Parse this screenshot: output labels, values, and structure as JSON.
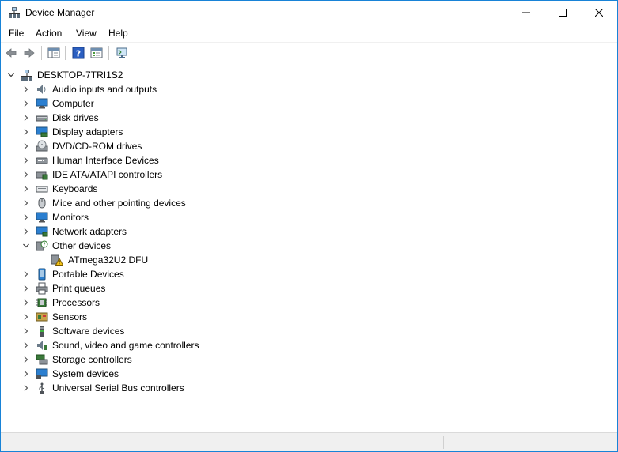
{
  "window": {
    "title": "Device Manager"
  },
  "menu": [
    "File",
    "Action",
    "View",
    "Help"
  ],
  "toolbar": {
    "buttons": [
      "back-icon",
      "forward-icon",
      "show-hide-console-tree-icon",
      "help-icon",
      "properties-icon",
      "scan-hardware-icon"
    ]
  },
  "tree": {
    "root": "DESKTOP-7TRI1S2",
    "categories": [
      {
        "label": "Audio inputs and outputs",
        "icon": "speaker-icon",
        "expanded": false
      },
      {
        "label": "Computer",
        "icon": "computer-icon",
        "expanded": false
      },
      {
        "label": "Disk drives",
        "icon": "disk-drive-icon",
        "expanded": false
      },
      {
        "label": "Display adapters",
        "icon": "display-adapter-icon",
        "expanded": false
      },
      {
        "label": "DVD/CD-ROM drives",
        "icon": "dvd-drive-icon",
        "expanded": false
      },
      {
        "label": "Human Interface Devices",
        "icon": "hid-icon",
        "expanded": false
      },
      {
        "label": "IDE ATA/ATAPI controllers",
        "icon": "ide-controller-icon",
        "expanded": false
      },
      {
        "label": "Keyboards",
        "icon": "keyboard-icon",
        "expanded": false
      },
      {
        "label": "Mice and other pointing devices",
        "icon": "mouse-icon",
        "expanded": false
      },
      {
        "label": "Monitors",
        "icon": "monitor-icon",
        "expanded": false
      },
      {
        "label": "Network adapters",
        "icon": "network-adapter-icon",
        "expanded": false
      },
      {
        "label": "Other devices",
        "icon": "unknown-device-icon",
        "expanded": true,
        "children": [
          {
            "label": "ATmega32U2 DFU",
            "icon": "warning-device-icon"
          }
        ]
      },
      {
        "label": "Portable Devices",
        "icon": "portable-device-icon",
        "expanded": false
      },
      {
        "label": "Print queues",
        "icon": "printer-icon",
        "expanded": false
      },
      {
        "label": "Processors",
        "icon": "processor-icon",
        "expanded": false
      },
      {
        "label": "Sensors",
        "icon": "sensor-icon",
        "expanded": false
      },
      {
        "label": "Software devices",
        "icon": "software-device-icon",
        "expanded": false
      },
      {
        "label": "Sound, video and game controllers",
        "icon": "sound-controller-icon",
        "expanded": false
      },
      {
        "label": "Storage controllers",
        "icon": "storage-controller-icon",
        "expanded": false
      },
      {
        "label": "System devices",
        "icon": "system-device-icon",
        "expanded": false
      },
      {
        "label": "Universal Serial Bus controllers",
        "icon": "usb-icon",
        "expanded": false
      }
    ]
  },
  "colors": {
    "accent": "#1883d7",
    "statusbar": "#f0f0f0"
  }
}
